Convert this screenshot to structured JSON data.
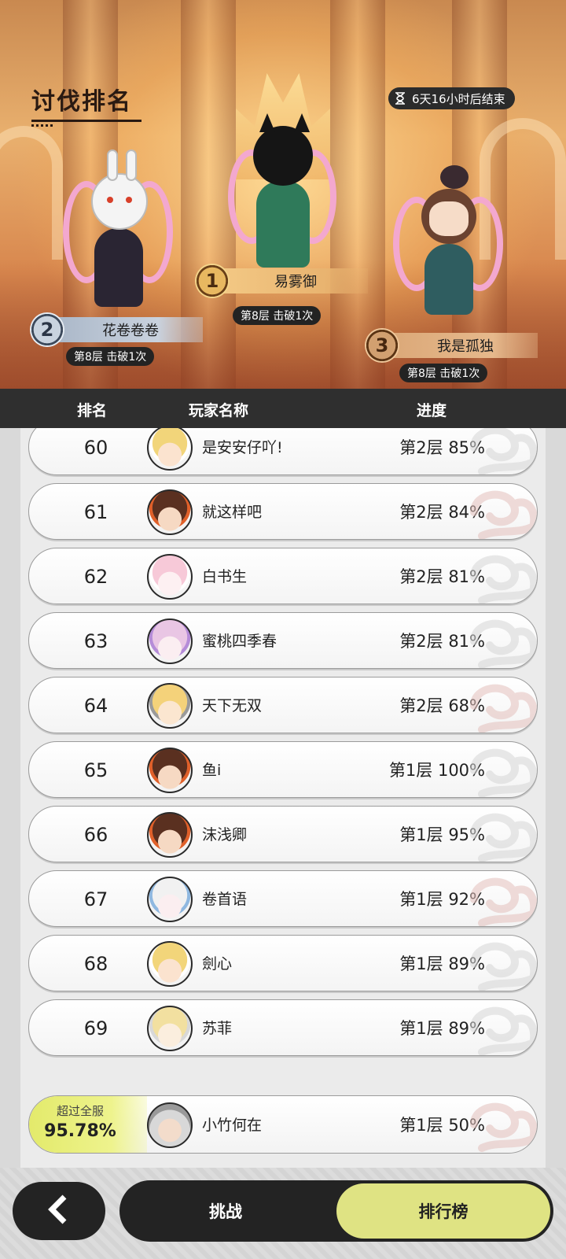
{
  "header": {
    "title": "讨伐排名",
    "timer_text": "6天16小时后结束"
  },
  "podium": [
    {
      "rank": "1",
      "name": "易雾御",
      "progress": "第8层 击破1次"
    },
    {
      "rank": "2",
      "name": "花卷卷卷",
      "progress": "第8层 击破1次"
    },
    {
      "rank": "3",
      "name": "我是孤独",
      "progress": "第8层 击破1次"
    }
  ],
  "table": {
    "columns": [
      "排名",
      "玩家名称",
      "进度"
    ],
    "rows": [
      {
        "rank": "60",
        "name": "是安安仔吖!",
        "progress": "第2层 85%"
      },
      {
        "rank": "61",
        "name": "就这样吧",
        "progress": "第2层 84%"
      },
      {
        "rank": "62",
        "name": "白书生",
        "progress": "第2层 81%"
      },
      {
        "rank": "63",
        "name": "蜜桃四季春",
        "progress": "第2层 81%"
      },
      {
        "rank": "64",
        "name": "天下无双",
        "progress": "第2层 68%"
      },
      {
        "rank": "65",
        "name": "鱼i",
        "progress": "第1层 100%"
      },
      {
        "rank": "66",
        "name": "沫浅卿",
        "progress": "第1层 95%"
      },
      {
        "rank": "67",
        "name": "卷首语",
        "progress": "第1层 92%"
      },
      {
        "rank": "68",
        "name": "劍心",
        "progress": "第1层 89%"
      },
      {
        "rank": "69",
        "name": "苏菲",
        "progress": "第1层 89%"
      }
    ]
  },
  "my_rank": {
    "percent_label": "超过全服",
    "percent_value": "95.78%",
    "name": "小竹何在",
    "progress": "第1层 50%"
  },
  "bottom_nav": {
    "back_icon": "chevron-left-icon",
    "challenge_label": "挑战",
    "ranking_label": "排行榜",
    "active_tab": "ranking",
    "active_color": "#dfe383"
  },
  "avatars": [
    {
      "hair": "#f2d57a",
      "skin": "#fbe3cf",
      "accent": "#ffffff"
    },
    {
      "hair": "#5a3020",
      "skin": "#f6d9c3",
      "accent": "#e0602a"
    },
    {
      "hair": "#f7c9d8",
      "skin": "#fdf0f2",
      "accent": "#ffffff"
    },
    {
      "hair": "#e9c6e4",
      "skin": "#fbeef1",
      "accent": "#b58cd8"
    },
    {
      "hair": "#f4d27a",
      "skin": "#fbe6d0",
      "accent": "#9a9a9a"
    },
    {
      "hair": "#5a3020",
      "skin": "#f6d9c3",
      "accent": "#e0602a"
    },
    {
      "hair": "#5a3020",
      "skin": "#f6d9c3",
      "accent": "#e0602a"
    },
    {
      "hair": "#f1f1f1",
      "skin": "#fbeef0",
      "accent": "#8fb8e0"
    },
    {
      "hair": "#f2d57a",
      "skin": "#fbe3cf",
      "accent": "#ffffff"
    },
    {
      "hair": "#f2e0a0",
      "skin": "#fbeede",
      "accent": "#d8d8d8"
    }
  ]
}
